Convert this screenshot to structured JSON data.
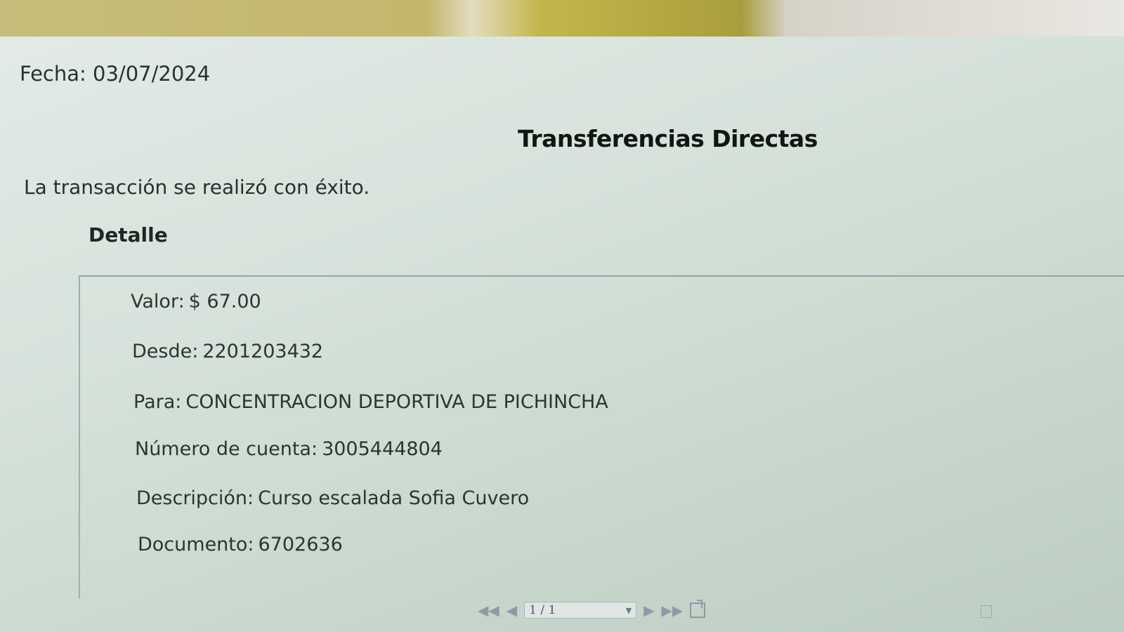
{
  "header": {
    "fecha_label": "Fecha:",
    "fecha_value": "03/07/2024",
    "title": "Transferencias Directas",
    "status_message": "La transacción se realizó con éxito."
  },
  "detail": {
    "heading": "Detalle",
    "rows": [
      {
        "label": "Valor:",
        "value": "$ 67.00"
      },
      {
        "label": "Desde:",
        "value": "2201203432"
      },
      {
        "label": "Para:",
        "value": "CONCENTRACION DEPORTIVA DE PICHINCHA"
      },
      {
        "label": "Número de cuenta:",
        "value": "3005444804"
      },
      {
        "label": "Descripción:",
        "value": "Curso escalada Sofia Cuvero"
      },
      {
        "label": "Documento:",
        "value": "6702636"
      }
    ]
  },
  "pager": {
    "first_glyph": "◀◀",
    "prev_glyph": "◀",
    "page_value": "1 / 1",
    "next_glyph": "▶",
    "last_glyph": "▶▶",
    "dropdown_glyph": "▼"
  },
  "icons": {
    "first_page": "first-page-icon",
    "prev_page": "prev-page-icon",
    "next_page": "next-page-icon",
    "last_page": "last-page-icon",
    "export": "export-icon",
    "document": "document-icon"
  }
}
